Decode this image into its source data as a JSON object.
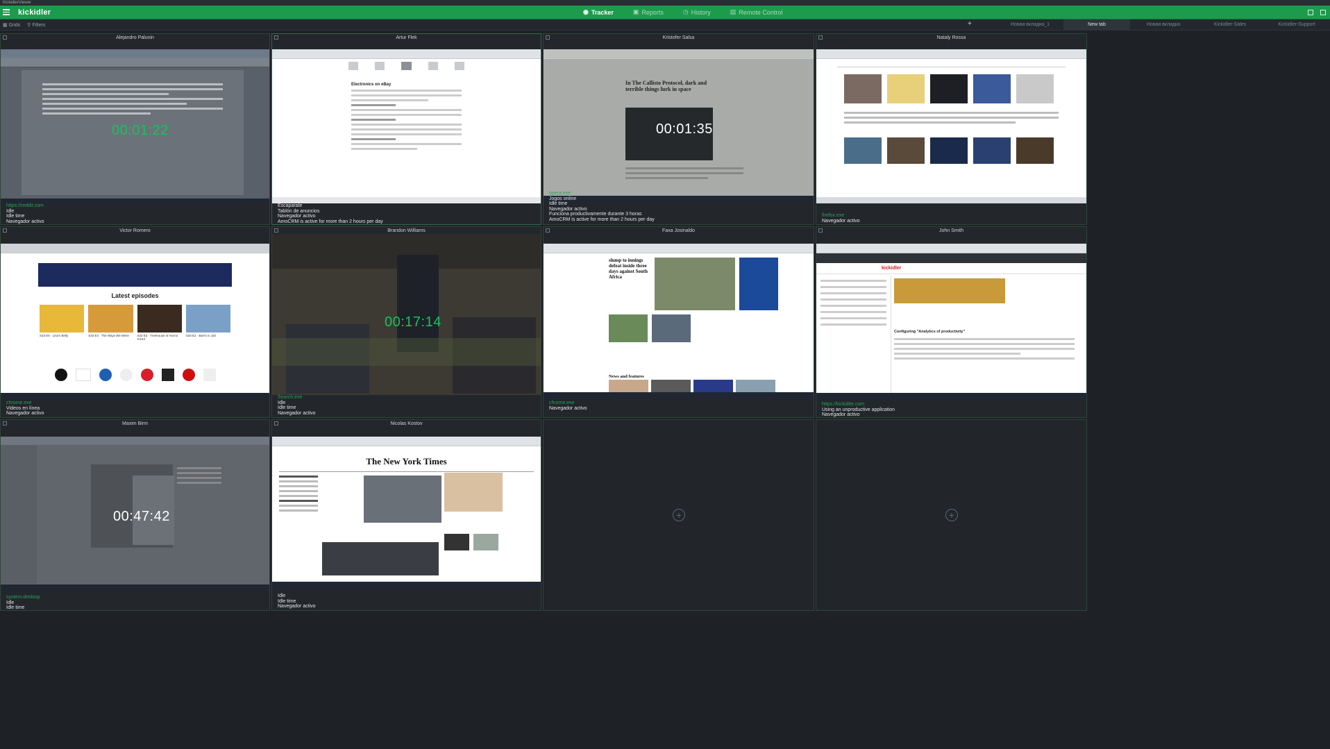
{
  "window_title": "KickidlerViewer",
  "app": {
    "logo": "kickidler"
  },
  "menu": {
    "tracker": "Tracker",
    "reports": "Reports",
    "history": "History",
    "remote": "Remote Control"
  },
  "toolbar": {
    "grids": "Grids",
    "filters": "Filters"
  },
  "tabs": [
    "Новая вкладка_1",
    "New tab",
    "Новая вкладка",
    "Kickidler-Sales",
    "Kickidler-Support"
  ],
  "cells": [
    {
      "name": "Alejandro Palunin",
      "timer": "00:01:22",
      "app": "https://reddit.com",
      "lines": [
        "Idle",
        "Idle time",
        "Navegador activo"
      ]
    },
    {
      "name": "Artur Flek",
      "timer": "",
      "app": "",
      "lines": [
        "Escaparate",
        "Tablón de anuncios",
        "Navegador activo",
        "AmoCRM is active for more than 2 hours per day"
      ]
    },
    {
      "name": "Kristofer Salsa",
      "timer": "00:01:35",
      "app": "opera.exe",
      "lines": [
        "Jogos online",
        "Idle time",
        "Navegador activo",
        "Funciona productivamente durante 3 horas",
        "AmoCRM is active for more than 2 hours per day"
      ]
    },
    {
      "name": "Nataly Rossa",
      "timer": "",
      "app": "firefox.exe",
      "lines": [
        "Navegador activo"
      ]
    },
    {
      "name": "Victor Romero",
      "timer": "",
      "app": "chrome.exe",
      "lines": [
        "Videos en línea",
        "Navegador activo"
      ]
    },
    {
      "name": "Brandon Williams",
      "timer": "00:17:14",
      "app": "Search.exe",
      "lines": [
        "Idle",
        "Idle time",
        "Navegador activo"
      ]
    },
    {
      "name": "Faxa Josinaldo",
      "timer": "",
      "app": "chrome.exe",
      "lines": [
        "Navegador activo"
      ]
    },
    {
      "name": "John Smith",
      "timer": "",
      "app": "https://kickidler.com",
      "lines": [
        "Using an unproductive application",
        "Navegador activo"
      ]
    },
    {
      "name": "Maxim Birm",
      "timer": "00:47:42",
      "app": "system.desktop",
      "lines": [
        "Idle",
        "Idle time"
      ]
    },
    {
      "name": "Nicolas Kostov",
      "timer": "",
      "app": "",
      "lines": [
        "Idle",
        "Idle time",
        "Navegador activo"
      ]
    }
  ],
  "screens": {
    "nyt_title": "The New York Times",
    "callisto": "In The Callisto Protocol, dark and terrible things lurk in space",
    "latest": "Latest episodes",
    "episodes": [
      "S33 E5 · Lisa's Belly",
      "S33 E4 · The Ways We Were",
      "S33 E3 · Treehouse of Horror XXXII",
      "S33 E2 · Bart's in Jail"
    ],
    "article_h1": "Electronics on eBay",
    "cricket": "slump to innings defeat inside three days against South Africa",
    "news_features": "News and features",
    "kick_heading": "Configuring \"Analytics of productivity\""
  }
}
